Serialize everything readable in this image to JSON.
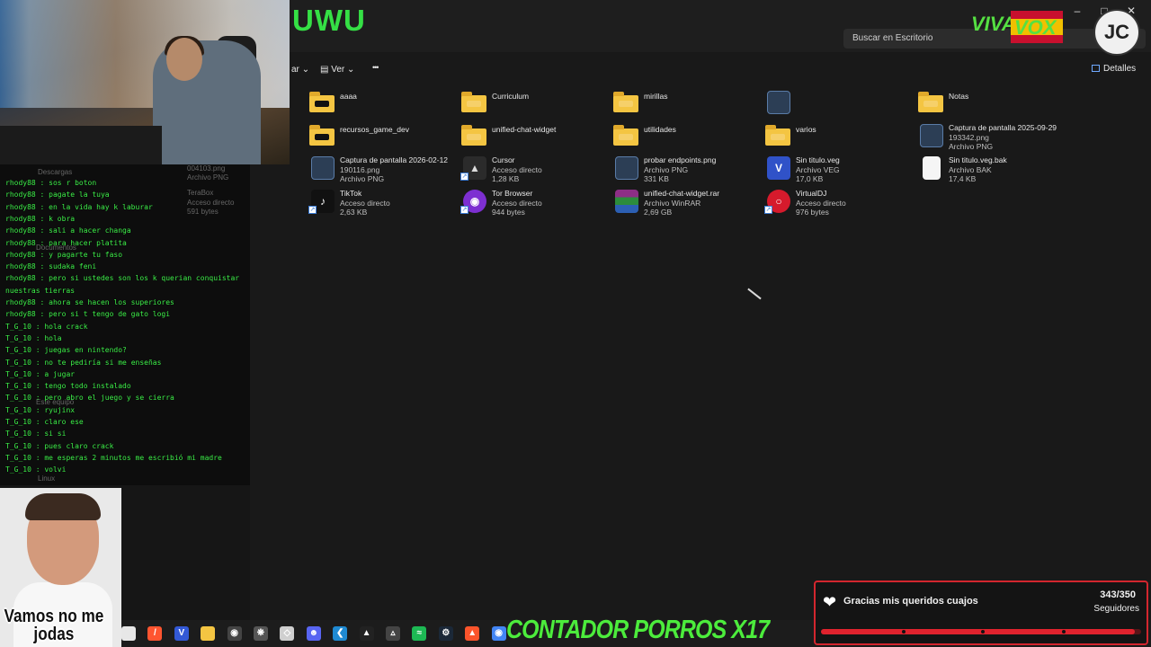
{
  "window": {
    "title": "UWU",
    "search_placeholder": "Buscar en Escritorio",
    "toolbar": {
      "partial_label": "ar",
      "view_label": "Ver",
      "more_label": "•••",
      "details_label": "Detalles"
    }
  },
  "files": [
    {
      "name": "aaaa",
      "line2": "",
      "line3": "",
      "line4": "",
      "icon": "folder-icon"
    },
    {
      "name": "Curriculum",
      "line2": "",
      "line3": "",
      "line4": "",
      "icon": "folder-icon"
    },
    {
      "name": "mirillas",
      "line2": "",
      "line3": "",
      "line4": "",
      "icon": "folder-icon"
    },
    {
      "name": "",
      "line2": "",
      "line3": "",
      "line4": "",
      "icon": "image-file-icon"
    },
    {
      "name": "Notas",
      "line2": "",
      "line3": "",
      "line4": "",
      "icon": "folder-icon"
    },
    {
      "name": "recursos_game_dev",
      "line2": "",
      "line3": "",
      "line4": "",
      "icon": "folder-icon"
    },
    {
      "name": "unified-chat-widget",
      "line2": "",
      "line3": "",
      "line4": "",
      "icon": "folder-icon"
    },
    {
      "name": "utilidades",
      "line2": "",
      "line3": "",
      "line4": "",
      "icon": "folder-icon"
    },
    {
      "name": "varios",
      "line2": "",
      "line3": "",
      "line4": "",
      "icon": "folder-icon"
    },
    {
      "name": "Captura de pantalla 2025-09-29",
      "line2": "193342.png",
      "line3": "Archivo PNG",
      "line4": "",
      "icon": "image-file-icon"
    },
    {
      "name": "Captura de pantalla 2026-02-12",
      "line2": "190116.png",
      "line3": "Archivo PNG",
      "line4": "",
      "icon": "image-file-icon"
    },
    {
      "name": "Cursor",
      "line2": "Acceso directo",
      "line3": "1,28 KB",
      "line4": "",
      "icon": "cursor-app-icon"
    },
    {
      "name": "probar endpoints.png",
      "line2": "Archivo PNG",
      "line3": "331 KB",
      "line4": "",
      "icon": "image-file-icon"
    },
    {
      "name": "Sin titulo.veg",
      "line2": "Archivo VEG",
      "line3": "17,0 KB",
      "line4": "",
      "icon": "vegas-file-icon"
    },
    {
      "name": "Sin titulo.veg.bak",
      "line2": "Archivo BAK",
      "line3": "17,4 KB",
      "line4": "",
      "icon": "blank-file-icon"
    },
    {
      "name": "TikTok",
      "line2": "Acceso directo",
      "line3": "2,63 KB",
      "line4": "",
      "icon": "tiktok-icon"
    },
    {
      "name": "Tor Browser",
      "line2": "Acceso directo",
      "line3": "944 bytes",
      "line4": "",
      "icon": "tor-browser-icon"
    },
    {
      "name": "unified-chat-widget.rar",
      "line2": "Archivo WinRAR",
      "line3": "2,69 GB",
      "line4": "",
      "icon": "winrar-icon"
    },
    {
      "name": "VirtualDJ",
      "line2": "Acceso directo",
      "line3": "976 bytes",
      "line4": "",
      "icon": "virtualdj-icon"
    }
  ],
  "ghost_texts": [
    "Descargas",
    "004103.png",
    "Archivo PNG",
    "TeraBox",
    "Acceso directo",
    "591 bytes",
    "Documentos",
    "Este equipo",
    "Linux"
  ],
  "chat": [
    {
      "user": "rhody88",
      "text": "sos r boton"
    },
    {
      "user": "rhody88",
      "text": "pagate la tuya"
    },
    {
      "user": "rhody88",
      "text": "en la vida hay k laburar"
    },
    {
      "user": "rhody88",
      "text": "k obra"
    },
    {
      "user": "rhody88",
      "text": "sali a hacer changa"
    },
    {
      "user": "rhody88",
      "text": "para hacer platita"
    },
    {
      "user": "rhody88",
      "text": "y pagarte tu faso"
    },
    {
      "user": "rhody88",
      "text": "sudaka feni"
    },
    {
      "user": "rhody88",
      "text": "pero si ustedes son los k querian conquistar"
    },
    {
      "user": "",
      "text": "nuestras tierras"
    },
    {
      "user": "rhody88",
      "text": "ahora se hacen los superiores"
    },
    {
      "user": "rhody88",
      "text": "pero si t tengo de gato logi"
    },
    {
      "user": "T_G_10",
      "text": "hola crack"
    },
    {
      "user": "T_G_10",
      "text": "hola"
    },
    {
      "user": "T_G_10",
      "text": "juegas en nintendo?"
    },
    {
      "user": "T_G_10",
      "text": "no te pediría si me enseñas"
    },
    {
      "user": "T_G_10",
      "text": "a jugar"
    },
    {
      "user": "T_G_10",
      "text": "tengo todo instalado"
    },
    {
      "user": "T_G_10",
      "text": "pero abro el juego y se cierra"
    },
    {
      "user": "T_G_10",
      "text": "ryujinx"
    },
    {
      "user": "T_G_10",
      "text": "claro ese"
    },
    {
      "user": "T_G_10",
      "text": "si si"
    },
    {
      "user": "T_G_10",
      "text": "pues claro crack"
    },
    {
      "user": "T_G_10",
      "text": "me esperas 2 minutos me escribió mi madre"
    },
    {
      "user": "T_G_10",
      "text": "volvi"
    }
  ],
  "overlays": {
    "viva_text": "VIVA",
    "vox_text": "VOX",
    "logo_text": "JC",
    "face_caption": "Vamos no me jodas",
    "counter_text": "CONTADOR PORROS X17"
  },
  "goal": {
    "label": "Gracias mis queridos cuajos",
    "count": "343/350",
    "unit": "Seguidores",
    "progress": 0.98
  },
  "taskbar": [
    "chrome-icon",
    "opera-icon",
    "vegas-icon",
    "explorer-icon",
    "obs-icon",
    "chatgpt-icon",
    "cube-icon",
    "discord-icon",
    "vscode-icon",
    "cursor-icon",
    "unity-icon",
    "spotify-icon",
    "steam-icon",
    "brave-icon",
    "chrome-icon"
  ],
  "colors": {
    "accent_green": "#35e045",
    "goal_red": "#e0222d",
    "explorer_bg": "#191919"
  }
}
